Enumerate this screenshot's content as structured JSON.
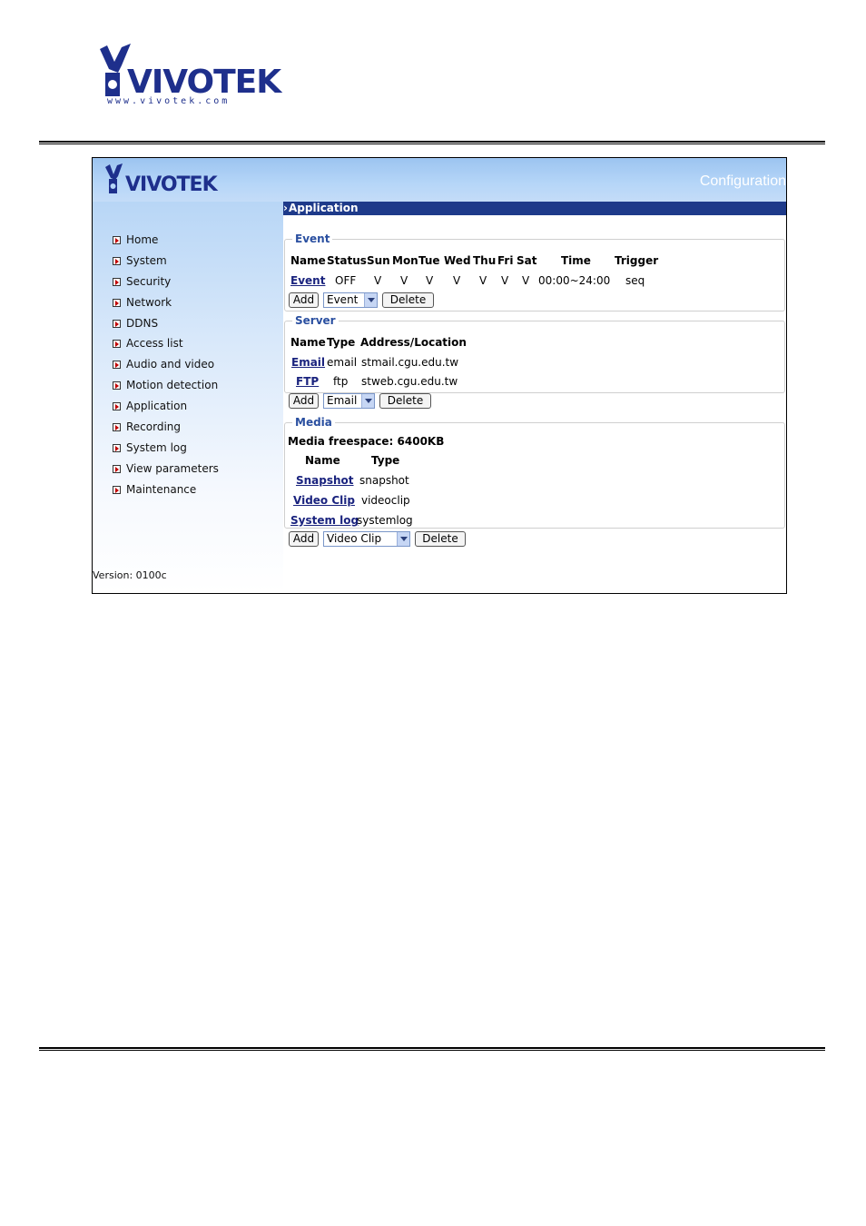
{
  "banner": {
    "title": "Configuration"
  },
  "sidebar": {
    "items": [
      {
        "label": "Home"
      },
      {
        "label": "System"
      },
      {
        "label": "Security"
      },
      {
        "label": "Network"
      },
      {
        "label": "DDNS"
      },
      {
        "label": "Access list"
      },
      {
        "label": "Audio and video"
      },
      {
        "label": "Motion detection"
      },
      {
        "label": "Application"
      },
      {
        "label": "Recording"
      },
      {
        "label": "System log"
      },
      {
        "label": "View parameters"
      },
      {
        "label": "Maintenance"
      }
    ],
    "version": "Version: 0100c"
  },
  "page_title": "Application",
  "event": {
    "legend": "Event",
    "headers": [
      "Name",
      "Status",
      "Sun",
      "Mon",
      "Tue",
      "Wed",
      "Thu",
      "Fri",
      "Sat",
      "Time",
      "Trigger"
    ],
    "row": {
      "name": "Event",
      "status": "OFF",
      "sun": "V",
      "mon": "V",
      "tue": "V",
      "wed": "V",
      "thu": "V",
      "fri": "V",
      "sat": "V",
      "time": "00:00~24:00",
      "trigger": "seq"
    },
    "add": "Add",
    "select": "Event",
    "delete": "Delete"
  },
  "server": {
    "legend": "Server",
    "headers": [
      "Name",
      "Type",
      "Address/Location"
    ],
    "rows": [
      {
        "name": "Email",
        "type": "email",
        "address": "stmail.cgu.edu.tw"
      },
      {
        "name": "FTP",
        "type": "ftp",
        "address": "stweb.cgu.edu.tw"
      }
    ],
    "add": "Add",
    "select": "Email",
    "delete": "Delete"
  },
  "media": {
    "legend": "Media",
    "freespace": "Media freespace: 6400KB",
    "headers": [
      "Name",
      "Type"
    ],
    "rows": [
      {
        "name": "Snapshot",
        "type": "snapshot"
      },
      {
        "name": "Video Clip",
        "type": "videoclip"
      },
      {
        "name": "System log",
        "type": "systemlog"
      }
    ],
    "add": "Add",
    "select": "Video Clip",
    "delete": "Delete"
  },
  "colors": {
    "banner": "#9cc4f0",
    "title_bar": "#1e3a8a",
    "legend": "#2a4fa0",
    "link": "#1a237e",
    "logo": "#1e2f8c"
  }
}
